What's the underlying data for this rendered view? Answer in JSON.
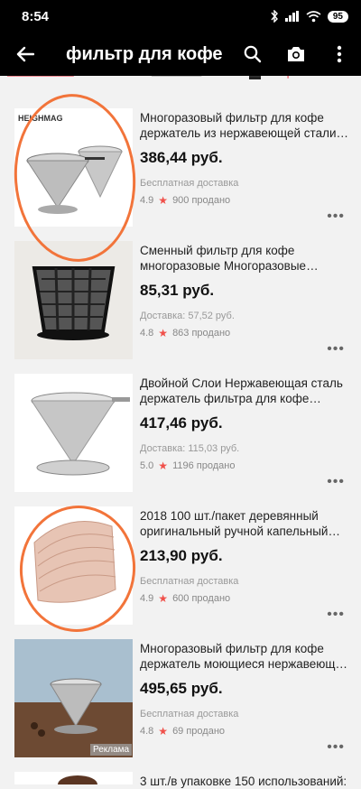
{
  "status": {
    "time": "8:54",
    "battery": "95"
  },
  "header": {
    "title": "фильтр для кофе"
  },
  "colors": {
    "accent_circle": "#f2743a",
    "star": "#f0504a",
    "bar": "#000000"
  },
  "products": [
    {
      "name": "Многоразовый фильтр для кофе держатель из нержавеющей стали ме…",
      "price": "386,44 руб.",
      "shipping": "Бесплатная доставка",
      "rating": "4.9",
      "sold": "900 продано",
      "brand": "HEIGHMAG"
    },
    {
      "name": "Сменный фильтр для кофе многоразовые Многоразовые корзин…",
      "price": "85,31 руб.",
      "shipping": "Доставка: 57,52 руб.",
      "rating": "4.8",
      "sold": "863 продано"
    },
    {
      "name": "Двойной Слои Нержавеющая сталь держатель фильтра для кофе залить …",
      "price": "417,46 руб.",
      "shipping": "Доставка: 115,03 руб.",
      "rating": "5.0",
      "sold": "1196 продано"
    },
    {
      "name": "2018 100 шт./пакет деревянный оригинальный ручной капельный бум…",
      "price": "213,90 руб.",
      "shipping": "Бесплатная доставка",
      "rating": "4.9",
      "sold": "600 продано"
    },
    {
      "name": "Многоразовый фильтр для кофе держатель моющиеся нержавеющая …",
      "price": "495,65 руб.",
      "shipping": "Бесплатная доставка",
      "rating": "4.8",
      "sold": "69 продано",
      "ad": "Реклама"
    },
    {
      "name": "3 шт./в упаковке 150 использований:"
    }
  ]
}
